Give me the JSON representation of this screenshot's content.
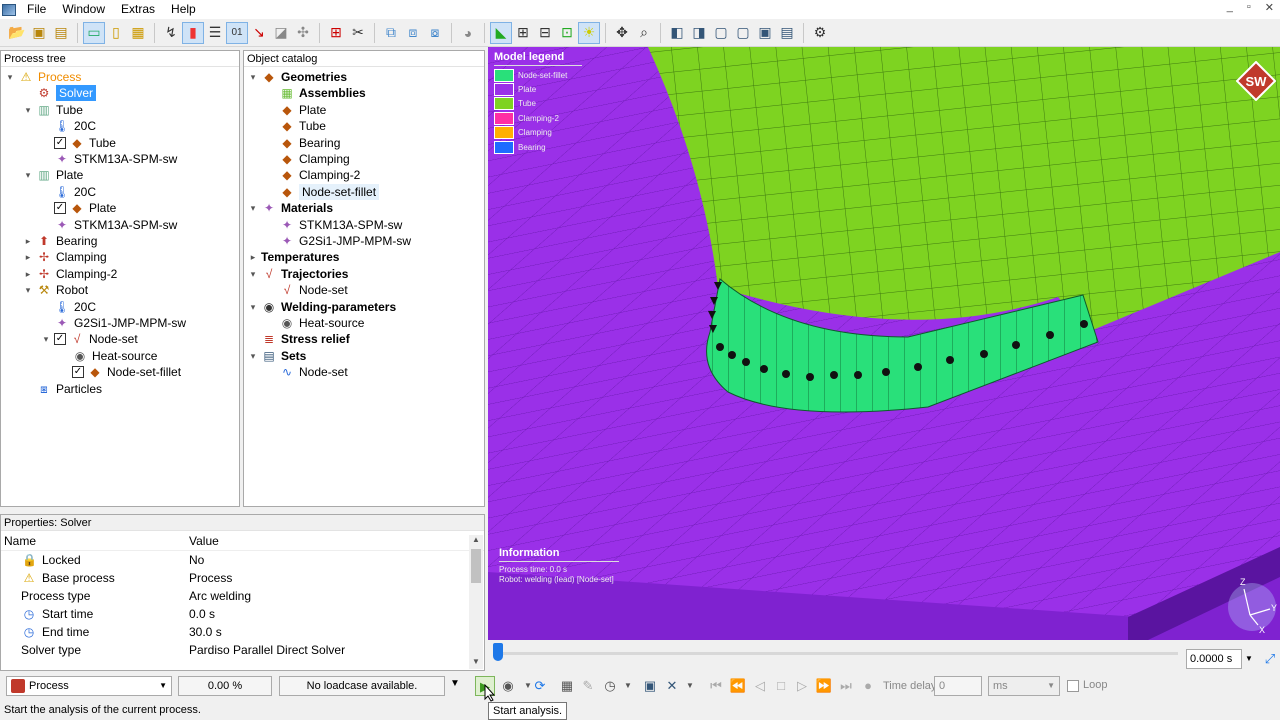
{
  "menubar": {
    "items": [
      "File",
      "Window",
      "Extras",
      "Help"
    ]
  },
  "toolbar": {
    "buttons": [
      "open-icon",
      "save-icon",
      "save-as-icon",
      "screenshot-icon",
      "clipboard-icon",
      "export-icon",
      "graph-icon",
      "colorbar-icon",
      "list-icon",
      "numbers-icon",
      "trajectory-icon",
      "transform-icon",
      "weld-icon",
      "measure-icon",
      "cut-icon",
      "copy-view-icon",
      "cube-icon",
      "cube-split-icon",
      "sphere-icon",
      "mesh-icon",
      "nodes-icon",
      "edges-icon",
      "surface-icon",
      "light-icon",
      "move-icon",
      "zoom-icon",
      "view-front-icon",
      "view-back-icon",
      "view-left-icon",
      "view-right-icon",
      "view-iso-icon",
      "settings-icon"
    ]
  },
  "process_tree": {
    "title": "Process tree",
    "rows": [
      {
        "label": "Process",
        "indent": 0,
        "arrow": "down",
        "icon": "warning-icon"
      },
      {
        "label": "Solver",
        "indent": 1,
        "icon": "solver-icon",
        "selected": true
      },
      {
        "label": "Tube",
        "indent": 1,
        "arrow": "down",
        "icon": "tube-icon"
      },
      {
        "label": "20C",
        "indent": 2,
        "icon": "temperature-icon"
      },
      {
        "label": "Tube",
        "indent": 2,
        "checkbox": true,
        "icon": "geometry-icon"
      },
      {
        "label": "STKM13A-SPM-sw",
        "indent": 2,
        "icon": "material-icon"
      },
      {
        "label": "Plate",
        "indent": 1,
        "arrow": "down",
        "icon": "plate-icon"
      },
      {
        "label": "20C",
        "indent": 2,
        "icon": "temperature-icon"
      },
      {
        "label": "Plate",
        "indent": 2,
        "checkbox": true,
        "icon": "geometry-icon"
      },
      {
        "label": "STKM13A-SPM-sw",
        "indent": 2,
        "icon": "material-icon"
      },
      {
        "label": "Bearing",
        "indent": 1,
        "arrow": "right",
        "icon": "bearing-icon"
      },
      {
        "label": "Clamping",
        "indent": 1,
        "arrow": "right",
        "icon": "clamping-icon"
      },
      {
        "label": "Clamping-2",
        "indent": 1,
        "arrow": "right",
        "icon": "clamping-icon"
      },
      {
        "label": "Robot",
        "indent": 1,
        "arrow": "down",
        "icon": "robot-icon"
      },
      {
        "label": "20C",
        "indent": 2,
        "icon": "temperature-icon"
      },
      {
        "label": "G2Si1-JMP-MPM-sw",
        "indent": 2,
        "icon": "material-icon"
      },
      {
        "label": "Node-set",
        "indent": 2,
        "arrow": "down",
        "checkbox": true,
        "icon": "trajectory-icon"
      },
      {
        "label": "Heat-source",
        "indent": 3,
        "icon": "heat-source-icon"
      },
      {
        "label": "Node-set-fillet",
        "indent": 3,
        "checkbox": true,
        "icon": "geometry-icon"
      },
      {
        "label": "Particles",
        "indent": 1,
        "icon": "particles-icon"
      }
    ]
  },
  "object_catalog": {
    "title": "Object catalog",
    "rows": [
      {
        "label": "Geometries",
        "indent": 0,
        "arrow": "down",
        "icon": "geometries-icon",
        "bold": true
      },
      {
        "label": "Assemblies",
        "indent": 1,
        "icon": "assemblies-icon",
        "bold": true
      },
      {
        "label": "Plate",
        "indent": 1,
        "icon": "geometry-icon"
      },
      {
        "label": "Tube",
        "indent": 1,
        "icon": "geometry-icon"
      },
      {
        "label": "Bearing",
        "indent": 1,
        "icon": "geometry-icon"
      },
      {
        "label": "Clamping",
        "indent": 1,
        "icon": "geometry-icon"
      },
      {
        "label": "Clamping-2",
        "indent": 1,
        "icon": "geometry-icon"
      },
      {
        "label": "Node-set-fillet",
        "indent": 1,
        "icon": "geometry-icon",
        "hl": true
      },
      {
        "label": "Materials",
        "indent": 0,
        "arrow": "down",
        "icon": "materials-icon",
        "bold": true
      },
      {
        "label": "STKM13A-SPM-sw",
        "indent": 1,
        "icon": "material-icon"
      },
      {
        "label": "G2Si1-JMP-MPM-sw",
        "indent": 1,
        "icon": "material-icon"
      },
      {
        "label": "Temperatures",
        "indent": 0,
        "arrow": "right",
        "icon": "",
        "bold": true
      },
      {
        "label": "Trajectories",
        "indent": 0,
        "arrow": "down",
        "icon": "trajectory-icon",
        "bold": true
      },
      {
        "label": "Node-set",
        "indent": 1,
        "icon": "trajectory-icon"
      },
      {
        "label": "Welding-parameters",
        "indent": 0,
        "arrow": "down",
        "icon": "welding-icon",
        "bold": true
      },
      {
        "label": "Heat-source",
        "indent": 1,
        "icon": "heat-source-icon"
      },
      {
        "label": "Stress relief",
        "indent": 0,
        "icon": "stress-icon",
        "bold": true
      },
      {
        "label": "Sets",
        "indent": 0,
        "arrow": "down",
        "icon": "sets-icon",
        "bold": true
      },
      {
        "label": "Node-set",
        "indent": 1,
        "icon": "node-set-icon"
      }
    ]
  },
  "properties": {
    "title": "Properties: Solver",
    "col_name": "Name",
    "col_value": "Value",
    "rows": [
      {
        "name": "Locked",
        "value": "No",
        "icon": "lock-icon"
      },
      {
        "name": "Base process",
        "value": "Process",
        "icon": "warning-icon"
      },
      {
        "name": "Process type",
        "value": "Arc welding",
        "icon": ""
      },
      {
        "name": "Start time",
        "value": "0.0 s",
        "icon": "clock-icon"
      },
      {
        "name": "End time",
        "value": "30.0 s",
        "icon": "clock-icon"
      },
      {
        "name": "Solver type",
        "value": "Pardiso Parallel Direct Solver",
        "icon": ""
      }
    ]
  },
  "viewport": {
    "legend_title": "Model legend",
    "legend": [
      {
        "label": "Node-set-fillet",
        "color": "#29e07a"
      },
      {
        "label": "Plate",
        "color": "#9a30e8"
      },
      {
        "label": "Tube",
        "color": "#7ed321"
      },
      {
        "label": "Clamping-2",
        "color": "#ff2fa3"
      },
      {
        "label": "Clamping",
        "color": "#ffb000"
      },
      {
        "label": "Bearing",
        "color": "#1e6cff"
      }
    ],
    "info_title": "Information",
    "info_lines": [
      "Process time: 0.0 s",
      "Robot: welding (lead) [Node-set]"
    ],
    "logo_text": "SW"
  },
  "timeline": {
    "time_value": "0.0000 s",
    "progress": 0.0
  },
  "bottombar": {
    "process_select": "Process",
    "progress_text": "0.00 %",
    "loadcase_text": "No loadcase available.",
    "time_delay_label": "Time delay:",
    "time_delay_value": "0",
    "unit": "ms",
    "loop_label": "Loop"
  },
  "statusbar": {
    "text": "Start the analysis of the current process."
  },
  "tooltip": {
    "text": "Start analysis."
  },
  "colors": {
    "plate": "#8a2be2",
    "tube": "#7ed321",
    "fillet": "#29e07a",
    "selection": "#3399ff"
  }
}
